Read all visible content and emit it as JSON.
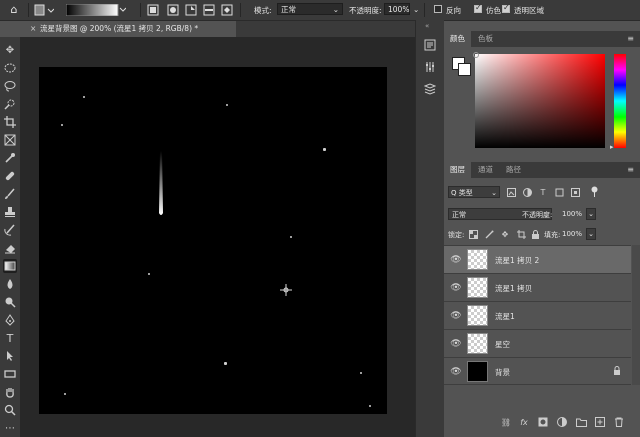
{
  "options_bar": {
    "mode_label": "模式:",
    "mode_value": "正常",
    "opacity_label": "不透明度:",
    "opacity_value": "100%",
    "reverse_label": "反向",
    "dither_label": "仿色",
    "transparency_label": "透明区域",
    "reverse_checked": false,
    "dither_checked": true,
    "transparency_checked": true
  },
  "document_tab": {
    "title": "流星背景图 @ 200% (流星1 拷贝 2, RGB/8) *",
    "close_glyph": "×"
  },
  "color_panel": {
    "tabs": [
      "颜色",
      "色板"
    ],
    "active_tab": "颜色",
    "hue": "#ff0000",
    "foreground": "#ffffff",
    "background": "#ffffff"
  },
  "layers_panel": {
    "tabs": [
      "图层",
      "通道",
      "路径"
    ],
    "active_tab": "图层",
    "filter_label": "Q 类型",
    "blend_mode": "正常",
    "opacity_label": "不透明度:",
    "opacity_value": "100%",
    "lock_label": "锁定:",
    "fill_label": "填充:",
    "fill_value": "100%",
    "layers": [
      {
        "name": "流星1 拷贝 2",
        "selected": true,
        "thumb": "transparent",
        "locked": false
      },
      {
        "name": "流星1 拷贝",
        "selected": false,
        "thumb": "transparent",
        "locked": false
      },
      {
        "name": "流星1",
        "selected": false,
        "thumb": "transparent",
        "locked": false
      },
      {
        "name": "星空",
        "selected": false,
        "thumb": "transparent",
        "locked": false
      },
      {
        "name": "背景",
        "selected": false,
        "thumb": "black",
        "locked": true
      }
    ]
  }
}
